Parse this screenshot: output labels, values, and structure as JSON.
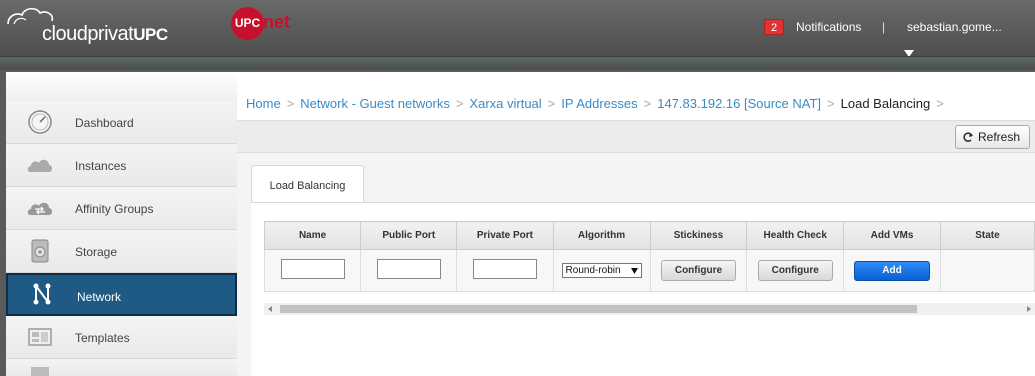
{
  "header": {
    "logo_main": "cloudprivat",
    "logo_bold": "UPC",
    "upc_circle": "UPC",
    "upc_net": "net",
    "notifications_count": "2",
    "notifications_label": "Notifications",
    "separator": "|",
    "user": "sebastian.gome..."
  },
  "sidebar": {
    "items": [
      {
        "label": "Dashboard",
        "icon": "dashboard-icon"
      },
      {
        "label": "Instances",
        "icon": "cloud-icon"
      },
      {
        "label": "Affinity Groups",
        "icon": "affinity-cloud-icon"
      },
      {
        "label": "Storage",
        "icon": "storage-icon"
      },
      {
        "label": "Network",
        "icon": "network-icon",
        "active": true
      },
      {
        "label": "Templates",
        "icon": "templates-icon"
      }
    ]
  },
  "breadcrumb": {
    "items": [
      "Home",
      "Network - Guest networks",
      "Xarxa virtual",
      "IP Addresses",
      "147.83.192.16 [Source NAT]"
    ],
    "current": "Load Balancing",
    "separator": ">"
  },
  "toolbar": {
    "refresh_label": "Refresh"
  },
  "tab": {
    "label": "Load Balancing"
  },
  "table": {
    "headers": [
      "Name",
      "Public Port",
      "Private Port",
      "Algorithm",
      "Stickiness",
      "Health Check",
      "Add VMs",
      "State"
    ],
    "row": {
      "name_value": "",
      "public_port_value": "",
      "private_port_value": "",
      "algorithm_selected": "Round-robin",
      "stickiness_button": "Configure",
      "health_button": "Configure",
      "add_button": "Add"
    }
  },
  "colors": {
    "accent": "#1e5a84",
    "link": "#3a8bc4",
    "brand_red": "#c8102e",
    "add_button": "#1a74e8"
  }
}
